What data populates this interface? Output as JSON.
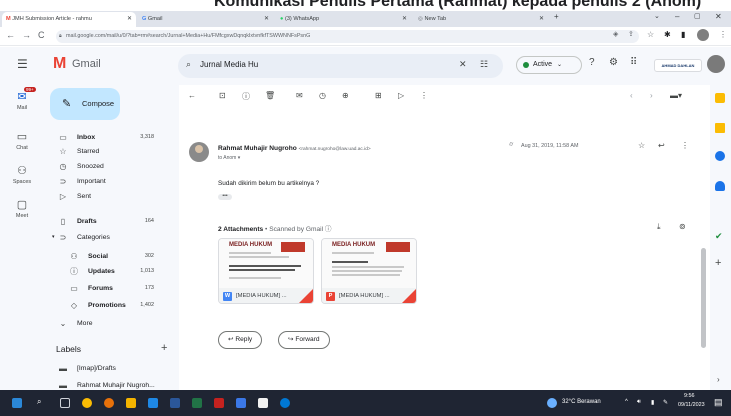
{
  "caption": "Komunikasi Penulis Pertama (Rahmat) kepada penulis 2 (Anom)",
  "browser": {
    "tabs": [
      {
        "title": "JMH Submission Article - rahmu",
        "icon_color": "#ea4335"
      },
      {
        "title": "Gmail",
        "icon_color": "#4285f4"
      },
      {
        "title": "(3) WhatsApp",
        "icon_color": "#25d366"
      },
      {
        "title": "New Tab",
        "icon_color": "#5f6368"
      }
    ],
    "url": "mail.google.com/mail/u/0/?tab=rm#search/Jurnal+Media+Hu/FMfcgxwDqnqkIxtvnfkfTSWWNNFsPsnG"
  },
  "gmail": {
    "app_name": "Gmail",
    "search_value": "Jurnal Media Hu",
    "status": "Active",
    "account_label": "AHMAD DAHLAN",
    "mail_badge": "99+",
    "compose": "Compose",
    "rail": [
      {
        "label": "Mail",
        "icon": "mail-icon"
      },
      {
        "label": "Chat",
        "icon": "chat-icon"
      },
      {
        "label": "Spaces",
        "icon": "spaces-icon"
      },
      {
        "label": "Meet",
        "icon": "meet-icon"
      }
    ],
    "nav": [
      {
        "label": "Inbox",
        "count": "3,318",
        "icon": "▭",
        "bold": true
      },
      {
        "label": "Starred",
        "count": "",
        "icon": "☆",
        "bold": false
      },
      {
        "label": "Snoozed",
        "count": "",
        "icon": "◷",
        "bold": false
      },
      {
        "label": "Important",
        "count": "",
        "icon": "⊃",
        "bold": false
      },
      {
        "label": "Sent",
        "count": "",
        "icon": "▷",
        "bold": false
      },
      {
        "label": "Drafts",
        "count": "164",
        "icon": "▯",
        "bold": true
      },
      {
        "label": "Categories",
        "count": "",
        "icon": "▾⊃",
        "bold": false
      },
      {
        "label": "Social",
        "count": "302",
        "icon": "⚇",
        "bold": true,
        "sub": true
      },
      {
        "label": "Updates",
        "count": "1,013",
        "icon": "ⓘ",
        "bold": true,
        "sub": true
      },
      {
        "label": "Forums",
        "count": "173",
        "icon": "▭",
        "bold": true,
        "sub": true
      },
      {
        "label": "Promotions",
        "count": "1,402",
        "icon": "◇",
        "bold": true,
        "sub": true
      },
      {
        "label": "More",
        "count": "",
        "icon": "⌄",
        "bold": false
      }
    ],
    "labels_heading": "Labels",
    "labels": [
      "[Imap]/Drafts",
      "Rahmat Muhajir Nugroh..."
    ]
  },
  "email": {
    "sender_name": "Rahmat Muhajir Nugroho",
    "sender_email": "<rahmat.nugroho@law.uad.ac.id>",
    "to": "to Anom",
    "date": "Aug 31, 2019, 11:58 AM",
    "body": "Sudah dikirim belum bu artikelnya ?",
    "attachments_count_label": "2 Attachments",
    "scanned_label": "Scanned by Gmail",
    "attachments": [
      {
        "name": "[MEDIA HUKUM] ...",
        "thumb_title": "MEDIA HUKUM",
        "type_letter": "W",
        "type_color": "#4285f4"
      },
      {
        "name": "[MEDIA HUKUM] ...",
        "thumb_title": "MEDIA HUKUM",
        "type_letter": "P",
        "type_color": "#ea4335"
      }
    ],
    "reply": "Reply",
    "forward": "Forward"
  },
  "taskbar": {
    "weather": "32°C  Berawan",
    "time": "9:56",
    "date": "09/11/2023"
  }
}
